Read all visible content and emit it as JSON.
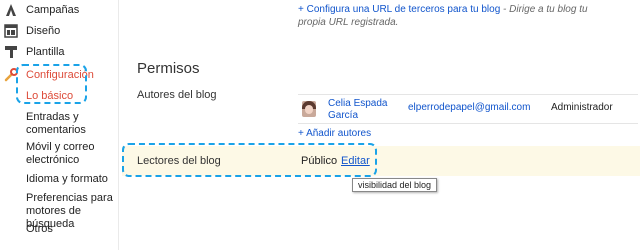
{
  "sidebar": {
    "items": [
      {
        "label": "Campañas",
        "icon": "campaigns-icon"
      },
      {
        "label": "Diseño",
        "icon": "layout-icon"
      },
      {
        "label": "Plantilla",
        "icon": "template-icon"
      },
      {
        "label": "Configuración",
        "icon": "wrench-icon",
        "selected": true
      },
      {
        "label": "Lo básico",
        "selected": true
      },
      {
        "label": "Entradas y comentarios"
      },
      {
        "label": "Móvil y correo electrónico"
      },
      {
        "label": "Idioma y formato"
      },
      {
        "label": "Preferencias para motores de búsqueda"
      },
      {
        "label": "Otros"
      }
    ]
  },
  "top_note": {
    "link": "+ Configura una URL de terceros para tu blog",
    "hint": "- Dirige a tu blog tu propia URL registrada."
  },
  "permisos": {
    "title": "Permisos",
    "authors_label": "Autores del blog",
    "author": {
      "name": "Celia Espada García",
      "email": "elperrodepapel@gmail.com",
      "role": "Administrador"
    },
    "add_authors": "+ Añadir autores",
    "readers_label": "Lectores del blog",
    "readers_value": "Público",
    "edit_label": "Editar",
    "tooltip": "visibilidad del blog"
  },
  "colors": {
    "accent": "#dd4b39",
    "link": "#1155cc",
    "highlight_box": "#1aa3e8",
    "readers_band": "#fdf9e6"
  }
}
